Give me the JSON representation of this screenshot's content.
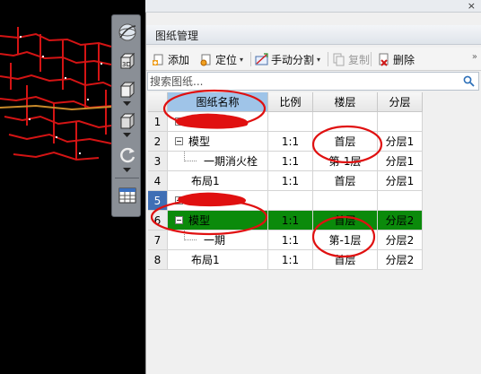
{
  "panel": {
    "title": "图纸管理",
    "close_glyph": "×"
  },
  "toolbar": {
    "add_label": "添加",
    "locate_label": "定位",
    "manual_split_label": "手动分割",
    "copy_label": "复制",
    "delete_label": "删除",
    "dropdown_glyph": "▾",
    "overflow_glyph": "»"
  },
  "search": {
    "placeholder": "搜索图纸..."
  },
  "viewbar": {
    "view3d_label": "3D"
  },
  "table": {
    "headers": [
      "图纸名称",
      "比例",
      "楼层",
      "分层"
    ],
    "rows": [
      {
        "num": "1",
        "name": "",
        "scale": "",
        "floor": "",
        "layer": ""
      },
      {
        "num": "2",
        "name": "模型",
        "scale": "1:1",
        "floor": "首层",
        "layer": "分层1"
      },
      {
        "num": "3",
        "name": "一期消火栓",
        "scale": "1:1",
        "floor": "第-1层",
        "layer": "分层1"
      },
      {
        "num": "4",
        "name": "布局1",
        "scale": "1:1",
        "floor": "首层",
        "layer": "分层1"
      },
      {
        "num": "5",
        "name": "",
        "scale": "",
        "floor": "",
        "layer": ""
      },
      {
        "num": "6",
        "name": "模型",
        "scale": "1:1",
        "floor": "首层",
        "layer": "分层2"
      },
      {
        "num": "7",
        "name": "一期",
        "scale": "1:1",
        "floor": "第-1层",
        "layer": "分层2"
      },
      {
        "num": "8",
        "name": "布局1",
        "scale": "1:1",
        "floor": "首层",
        "layer": "分层2"
      }
    ]
  },
  "colors": {
    "highlight_row": "#0b8a0b",
    "selected_rownum": "#3f6fb5",
    "selected_header": "#9fc4e8",
    "annotation_red": "#e01010"
  }
}
